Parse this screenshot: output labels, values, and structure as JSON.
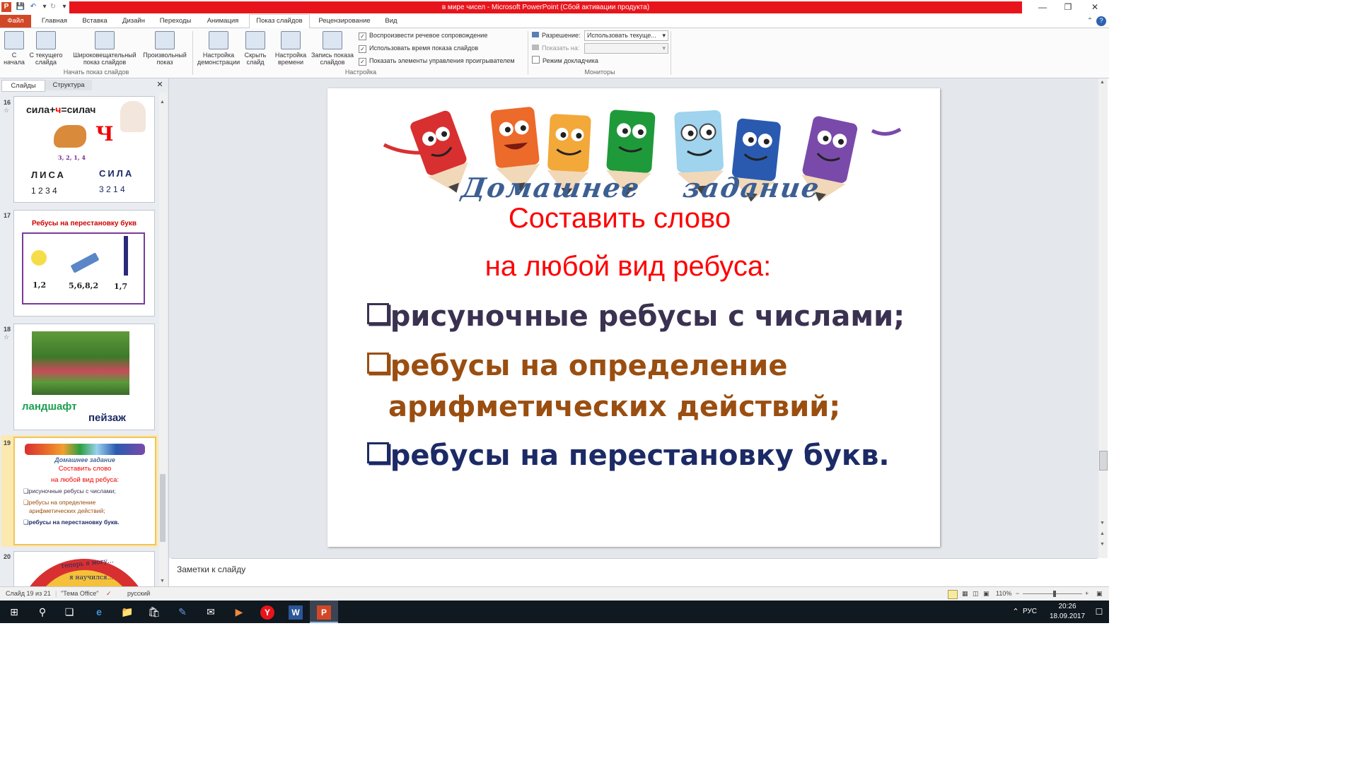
{
  "window": {
    "title": "в мире чисел  -  Microsoft PowerPoint (Сбой активации продукта)"
  },
  "tabs": [
    {
      "label": "Файл"
    },
    {
      "label": "Главная"
    },
    {
      "label": "Вставка"
    },
    {
      "label": "Дизайн"
    },
    {
      "label": "Переходы"
    },
    {
      "label": "Анимация"
    },
    {
      "label": "Показ слайдов"
    },
    {
      "label": "Рецензирование"
    },
    {
      "label": "Вид"
    }
  ],
  "ribbon": {
    "buttons": [
      {
        "label": "С начала"
      },
      {
        "label": "С текущего слайда"
      },
      {
        "label": "Широковещательный показ слайдов"
      },
      {
        "label": "Произвольный показ"
      },
      {
        "label": "Настройка демонстрации"
      },
      {
        "label": "Скрыть слайд"
      },
      {
        "label": "Настройка времени"
      },
      {
        "label": "Запись показа слайдов"
      }
    ],
    "groups": {
      "start": "Начать показ слайдов",
      "setup": "Настройка",
      "monitors": "Мониторы"
    },
    "checks": [
      {
        "label": "Воспроизвести речевое сопровождение",
        "checked": true
      },
      {
        "label": "Использовать время показа слайдов",
        "checked": true
      },
      {
        "label": "Показать элементы управления проигрывателем",
        "checked": true
      }
    ],
    "resolution_label": "Разрешение:",
    "resolution_value": "Использовать текуще...",
    "show_on_label": "Показать на:",
    "presenter_label": "Режим докладчика"
  },
  "panel_tabs": [
    {
      "label": "Слайды"
    },
    {
      "label": "Структура"
    }
  ],
  "thumbnails": {
    "s16": {
      "num": "16",
      "formula_a": "сила+",
      "formula_b": "ч",
      "formula_c": "=силач",
      "big_letter": "Ч",
      "order": "3, 2, 1, 4",
      "word1": "ЛИСА",
      "digits1": "1 2 3 4",
      "word2": "СИЛА",
      "digits2": "3 2 1 4"
    },
    "s17": {
      "num": "17",
      "title": "Ребусы на перестановку букв",
      "n1": "1,2",
      "n2": "5,6,8,2",
      "n3": "1,7"
    },
    "s18": {
      "num": "18",
      "word1": "ландшафт",
      "word2": "пейзаж"
    },
    "s19": {
      "num": "19",
      "banner": "Домашнее   задание",
      "l1": "Составить слово",
      "l2": "на любой вид ребуса:",
      "b1": "рисуночные  ребусы с числами;",
      "b2": "ребусы на определение",
      "b2b": "арифметических  действий;",
      "b3": "ребусы на перестановку  букв."
    },
    "s20": {
      "num": "20",
      "t1": "теперь я могу...",
      "t2": "я научился..."
    }
  },
  "slide": {
    "banner": "Домашнее    задание",
    "line1": "Составить слово",
    "line2": "на любой вид ребуса:",
    "bullet1": "рисуночные ребусы с числами;",
    "bullet2a": "ребусы на определение",
    "bullet2b": "арифметических действий;",
    "bullet3": "ребусы на перестановку букв."
  },
  "notes": {
    "placeholder": "Заметки к слайду"
  },
  "status": {
    "slide": "Слайд 19 из 21",
    "theme": "\"Тема Office\"",
    "lang": "русский",
    "zoom": "110%"
  },
  "taskbar": {
    "lang": "РУС",
    "time": "20:26",
    "date": "18.09.2017"
  },
  "colors": {
    "accent_red": "#e8141c",
    "file_tab": "#d24726",
    "text_red": "#ff0000",
    "purple": "#3b3150",
    "brown": "#9a4e10",
    "navy": "#1c2a66"
  }
}
